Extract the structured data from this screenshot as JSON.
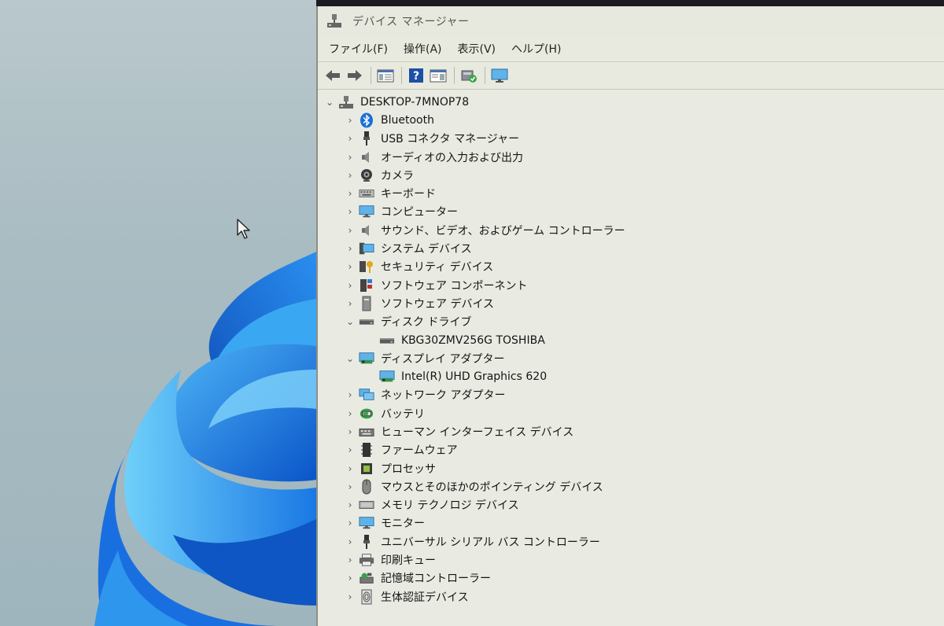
{
  "window": {
    "title": "デバイス マネージャー"
  },
  "menu": [
    {
      "label": "ファイル(F)"
    },
    {
      "label": "操作(A)"
    },
    {
      "label": "表示(V)"
    },
    {
      "label": "ヘルプ(H)"
    }
  ],
  "toolbar": {
    "buttons": [
      "back-icon",
      "forward-icon",
      "properties-pane-icon",
      "help-icon",
      "view-pane-icon",
      "scan-hardware-icon",
      "monitor-icon"
    ]
  },
  "tree": {
    "root": "DESKTOP-7MNOP78",
    "categories": [
      {
        "label": "Bluetooth",
        "icon": "bluetooth-icon",
        "expanded": false
      },
      {
        "label": "USB コネクタ マネージャー",
        "icon": "usb-connector-icon",
        "expanded": false
      },
      {
        "label": "オーディオの入力および出力",
        "icon": "speaker-icon",
        "expanded": false
      },
      {
        "label": "カメラ",
        "icon": "camera-icon",
        "expanded": false
      },
      {
        "label": "キーボード",
        "icon": "keyboard-icon",
        "expanded": false
      },
      {
        "label": "コンピューター",
        "icon": "computer-icon",
        "expanded": false
      },
      {
        "label": "サウンド、ビデオ、およびゲーム コントローラー",
        "icon": "sound-icon",
        "expanded": false
      },
      {
        "label": "システム デバイス",
        "icon": "system-device-icon",
        "expanded": false
      },
      {
        "label": "セキュリティ デバイス",
        "icon": "security-device-icon",
        "expanded": false
      },
      {
        "label": "ソフトウェア コンポーネント",
        "icon": "software-component-icon",
        "expanded": false
      },
      {
        "label": "ソフトウェア デバイス",
        "icon": "software-device-icon",
        "expanded": false
      },
      {
        "label": "ディスク ドライブ",
        "icon": "disk-drive-icon",
        "expanded": true,
        "children": [
          {
            "label": "KBG30ZMV256G TOSHIBA",
            "icon": "disk-drive-icon"
          }
        ]
      },
      {
        "label": "ディスプレイ アダプター",
        "icon": "display-adapter-icon",
        "expanded": true,
        "children": [
          {
            "label": "Intel(R) UHD Graphics 620",
            "icon": "display-adapter-icon"
          }
        ]
      },
      {
        "label": "ネットワーク アダプター",
        "icon": "network-adapter-icon",
        "expanded": false
      },
      {
        "label": "バッテリ",
        "icon": "battery-icon",
        "expanded": false
      },
      {
        "label": "ヒューマン インターフェイス デバイス",
        "icon": "hid-icon",
        "expanded": false
      },
      {
        "label": "ファームウェア",
        "icon": "firmware-icon",
        "expanded": false
      },
      {
        "label": "プロセッサ",
        "icon": "processor-icon",
        "expanded": false
      },
      {
        "label": "マウスとそのほかのポインティング デバイス",
        "icon": "mouse-icon",
        "expanded": false
      },
      {
        "label": "メモリ テクノロジ デバイス",
        "icon": "memory-icon",
        "expanded": false
      },
      {
        "label": "モニター",
        "icon": "monitor-icon",
        "expanded": false
      },
      {
        "label": "ユニバーサル シリアル バス コントローラー",
        "icon": "usb-controller-icon",
        "expanded": false
      },
      {
        "label": "印刷キュー",
        "icon": "printer-icon",
        "expanded": false
      },
      {
        "label": "記憶域コントローラー",
        "icon": "storage-controller-icon",
        "expanded": false
      },
      {
        "label": "生体認証デバイス",
        "icon": "biometric-icon",
        "expanded": false
      }
    ]
  },
  "colors": {
    "window_bg": "#e9ebe2",
    "wallpaper_bg": "#a9bcc2",
    "bloom_blue": "#1f7fe0",
    "bluetooth_blue": "#1a6fd8"
  }
}
